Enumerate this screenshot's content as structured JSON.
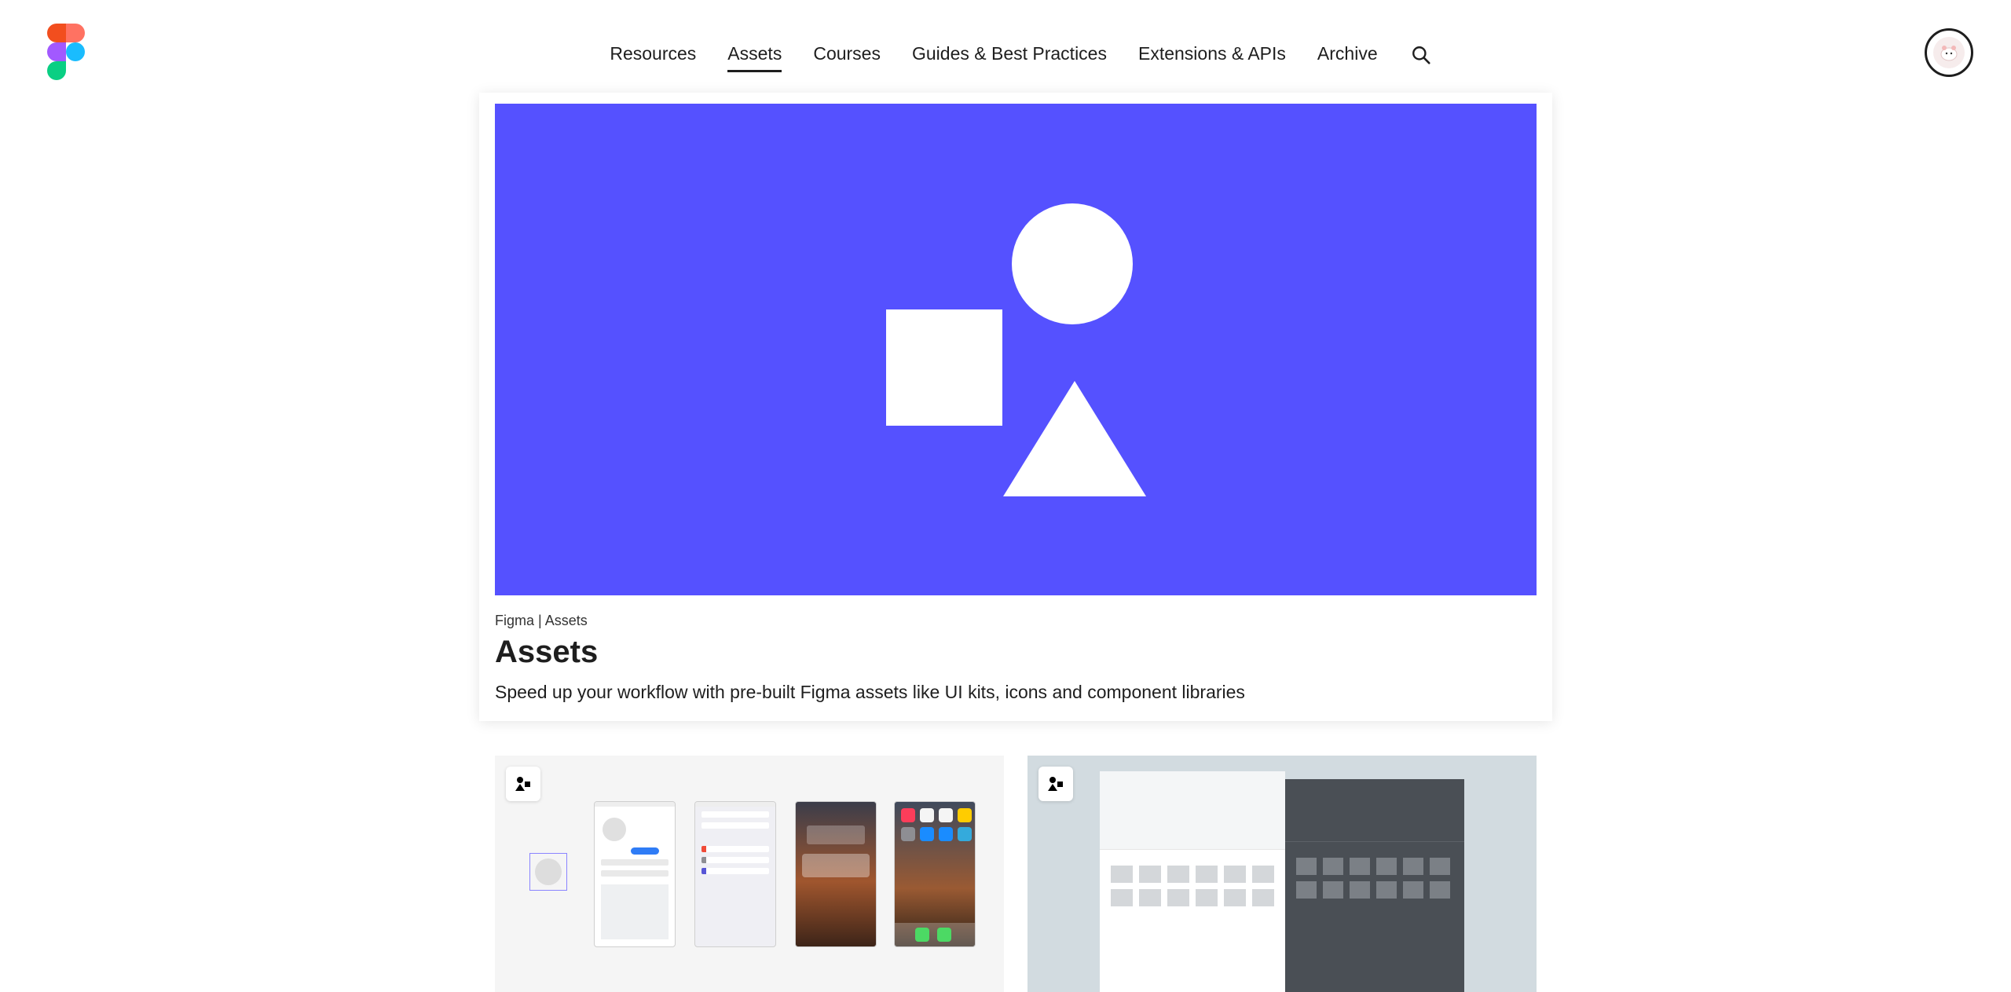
{
  "nav": {
    "items": [
      {
        "label": "Resources"
      },
      {
        "label": "Assets"
      },
      {
        "label": "Courses"
      },
      {
        "label": "Guides & Best Practices"
      },
      {
        "label": "Extensions & APIs"
      },
      {
        "label": "Archive"
      }
    ]
  },
  "hero": {
    "meta": "Figma | Assets",
    "title": "Assets",
    "description": "Speed up your workflow with pre-built Figma assets like UI kits, icons and component libraries"
  },
  "colors": {
    "banner": "#5551ff",
    "text": "#1e1e1e"
  }
}
